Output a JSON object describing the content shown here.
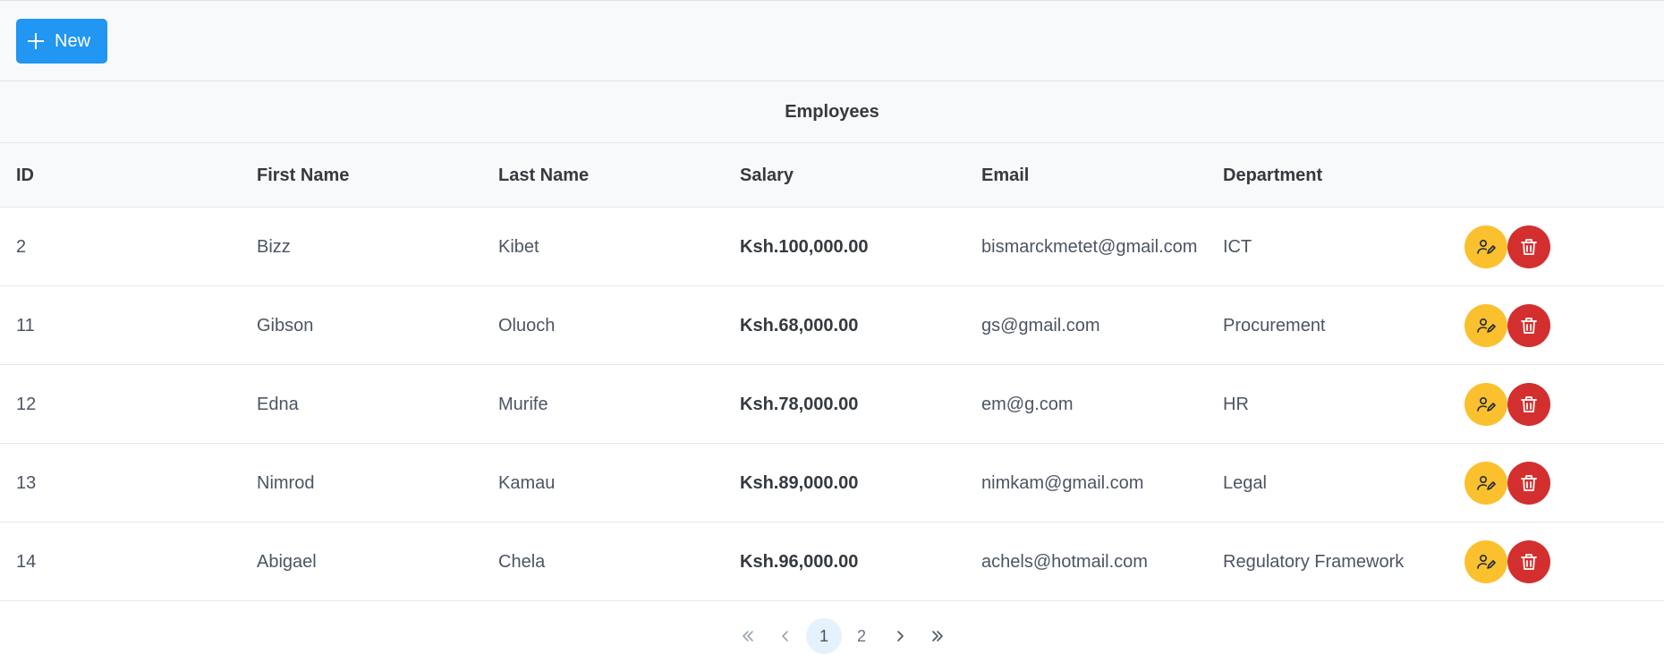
{
  "toolbar": {
    "new_label": "New"
  },
  "table": {
    "title": "Employees",
    "headers": {
      "id": "ID",
      "first_name": "First Name",
      "last_name": "Last Name",
      "salary": "Salary",
      "email": "Email",
      "department": "Department"
    },
    "rows": [
      {
        "id": "2",
        "first_name": "Bizz",
        "last_name": "Kibet",
        "salary": "Ksh.100,000.00",
        "email": "bismarckmetet@gmail.com",
        "department": "ICT"
      },
      {
        "id": "11",
        "first_name": "Gibson",
        "last_name": "Oluoch",
        "salary": "Ksh.68,000.00",
        "email": "gs@gmail.com",
        "department": "Procurement"
      },
      {
        "id": "12",
        "first_name": "Edna",
        "last_name": "Murife",
        "salary": "Ksh.78,000.00",
        "email": "em@g.com",
        "department": "HR"
      },
      {
        "id": "13",
        "first_name": "Nimrod",
        "last_name": "Kamau",
        "salary": "Ksh.89,000.00",
        "email": "nimkam@gmail.com",
        "department": "Legal"
      },
      {
        "id": "14",
        "first_name": "Abigael",
        "last_name": "Chela",
        "salary": "Ksh.96,000.00",
        "email": "achels@hotmail.com",
        "department": "Regulatory Framework"
      }
    ],
    "row_actions": {
      "edit_icon": "user-edit-icon",
      "delete_icon": "trash-icon"
    }
  },
  "paginator": {
    "pages": [
      "1",
      "2"
    ],
    "current_page": "1",
    "icons": {
      "first": "chevron-double-left-icon",
      "prev": "chevron-left-icon",
      "next": "chevron-right-icon",
      "last": "chevron-double-right-icon"
    }
  },
  "colors": {
    "primary": "#2196f3",
    "edit": "#fbc02d",
    "delete": "#d32f2f",
    "active_page_bg": "#e3f2fd"
  }
}
